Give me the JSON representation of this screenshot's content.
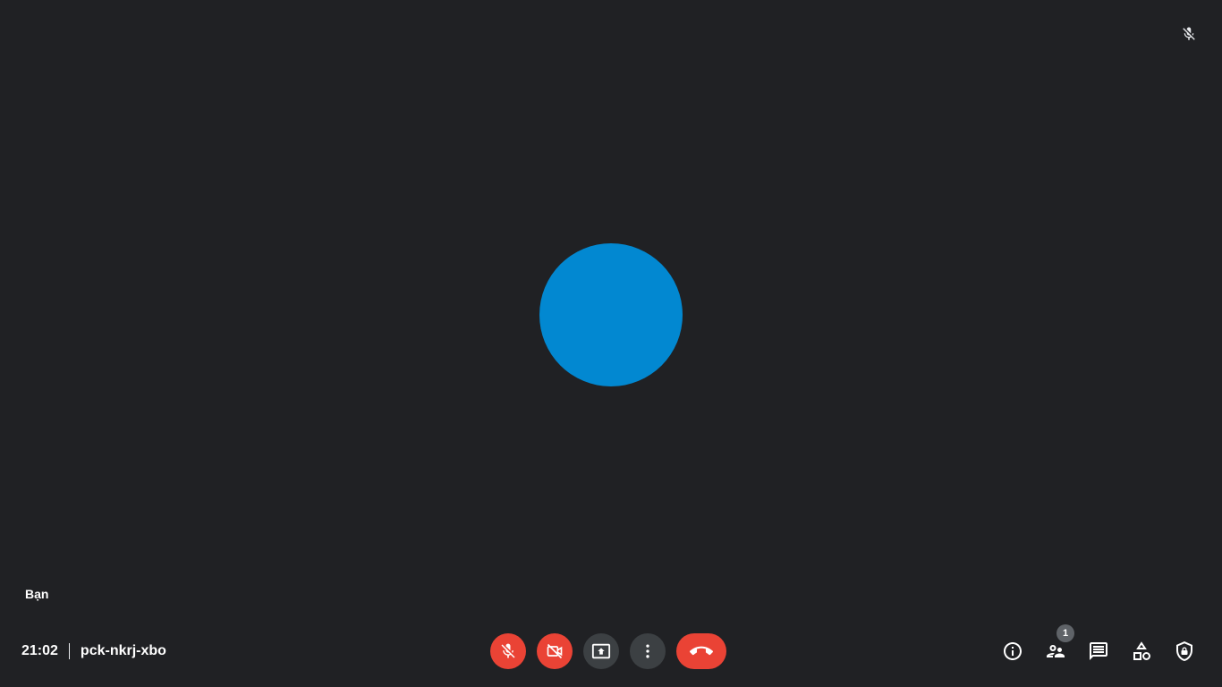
{
  "tile": {
    "participant_name": "Bạn",
    "mic_indicator_icon": "mic-off-icon",
    "avatar_color": "#0288d1"
  },
  "meeting": {
    "time": "21:02",
    "code": "pck-nkrj-xbo"
  },
  "controls": [
    {
      "name": "mic-toggle",
      "icon": "mic-off-icon",
      "state": "off",
      "color": "#ea4335"
    },
    {
      "name": "camera-toggle",
      "icon": "videocam-off-icon",
      "state": "off",
      "color": "#ea4335"
    },
    {
      "name": "present-screen",
      "icon": "present-to-all-icon",
      "color": "#3c4043"
    },
    {
      "name": "more-options",
      "icon": "more-vert-icon",
      "color": "#3c4043"
    },
    {
      "name": "leave-call",
      "icon": "call-end-icon",
      "color": "#ea4335"
    }
  ],
  "side_panel_buttons": [
    {
      "name": "meeting-details",
      "icon": "info-icon"
    },
    {
      "name": "people",
      "icon": "people-icon",
      "badge": "1"
    },
    {
      "name": "chat",
      "icon": "chat-icon"
    },
    {
      "name": "activities",
      "icon": "activities-icon"
    },
    {
      "name": "host-controls",
      "icon": "shield-lock-icon"
    }
  ],
  "colors": {
    "background": "#202124",
    "danger": "#ea4335",
    "neutral_button": "#3c4043",
    "badge": "#5f6368"
  }
}
